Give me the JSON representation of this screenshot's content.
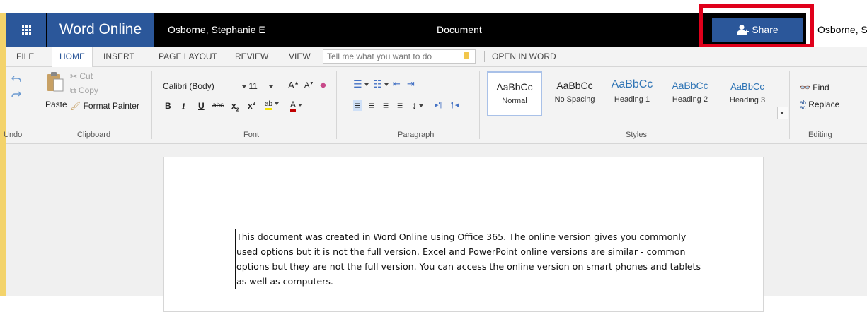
{
  "titlebar": {
    "app_name": "Word Online",
    "user_name": "Osborne, Stephanie E",
    "document_title": "Document",
    "share_label": "Share",
    "user_name_right": "Osborne, Ste"
  },
  "tabs": {
    "file": "FILE",
    "home": "HOME",
    "insert": "INSERT",
    "page_layout": "PAGE LAYOUT",
    "review": "REVIEW",
    "view": "VIEW",
    "tell_me_placeholder": "Tell me what you want to do",
    "open_in_word": "OPEN IN WORD"
  },
  "ribbon": {
    "undo": {
      "label": "Undo"
    },
    "clipboard": {
      "label": "Clipboard",
      "paste": "Paste",
      "cut": "Cut",
      "copy": "Copy",
      "format_painter": "Format Painter"
    },
    "font": {
      "label": "Font",
      "font_name": "Calibri (Body)",
      "font_size": "11",
      "grow": "A",
      "shrink": "A",
      "bold": "B",
      "italic": "I",
      "underline": "U",
      "strike": "abc",
      "subscript": "x",
      "superscript": "x",
      "subscript_mark": "2",
      "superscript_mark": "2",
      "highlight": "ab",
      "font_color": "A"
    },
    "paragraph": {
      "label": "Paragraph"
    },
    "styles": {
      "label": "Styles",
      "items": [
        {
          "sample": "AaBbCc",
          "name": "Normal"
        },
        {
          "sample": "AaBbCc",
          "name": "No Spacing"
        },
        {
          "sample": "AaBbCc",
          "name": "Heading 1"
        },
        {
          "sample": "AaBbCc",
          "name": "Heading 2"
        },
        {
          "sample": "AaBbCc",
          "name": "Heading 3"
        }
      ]
    },
    "editing": {
      "label": "Editing",
      "find": "Find",
      "replace": "Replace",
      "replace_glyph_top": "ab",
      "replace_glyph_bottom": "ac"
    }
  },
  "document": {
    "lines": [
      "This document was created in Word Online using Office 365.  The online version gives you commonly",
      "used options but it is not the full version.  Excel and PowerPoint online versions are similar - common",
      "options but they are not the full version.  You can access the online version on smart phones and tablets",
      "as well as computers."
    ]
  },
  "colors": {
    "brand": "#2b579a",
    "highlight_box": "#e0001b"
  }
}
